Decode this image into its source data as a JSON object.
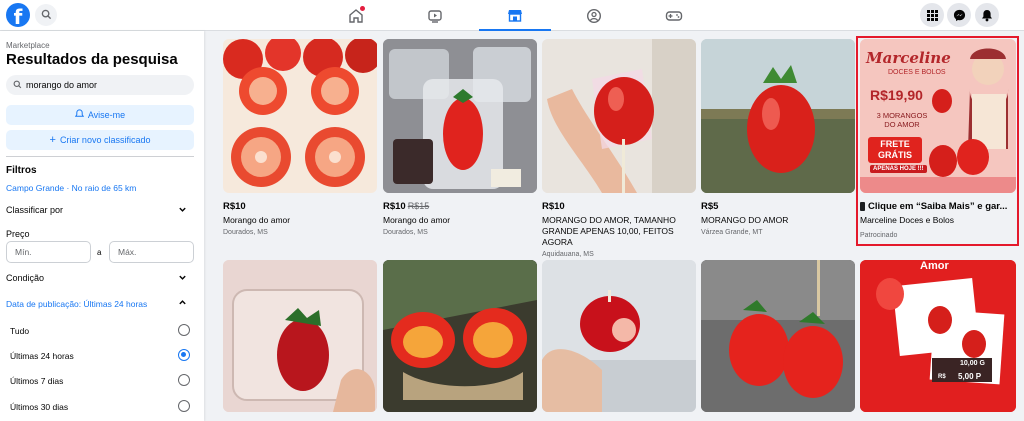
{
  "topbar": {
    "logo_letter": "f",
    "nav": [
      "home-icon",
      "video-icon",
      "marketplace-icon",
      "groups-icon",
      "gaming-icon"
    ],
    "active_nav": "marketplace-icon"
  },
  "sidebar": {
    "breadcrumb": "Marketplace",
    "title": "Resultados da pesquisa",
    "search_value": "morango do amor",
    "notify_label": "Avise-me",
    "create_label": "Criar novo classificado",
    "filters_title": "Filtros",
    "location_link": "Campo Grande · No raio de 65 km",
    "sort_label": "Classificar por",
    "price_label": "Preço",
    "price_min_placeholder": "Mín.",
    "price_sep": "a",
    "price_max_placeholder": "Máx.",
    "condition_label": "Condição",
    "date_label": "Data de publicação: Últimas 24 horas",
    "date_options": [
      {
        "label": "Tudo",
        "selected": false
      },
      {
        "label": "Últimas 24 horas",
        "selected": true
      },
      {
        "label": "Últimos 7 dias",
        "selected": false
      },
      {
        "label": "Últimos 30 dias",
        "selected": false
      }
    ]
  },
  "listings_row1": [
    {
      "price": "R$10",
      "old_price": "",
      "title": "Morango do amor",
      "location": "Dourados, MS"
    },
    {
      "price": "R$10",
      "old_price": "R$15",
      "title": "Morango do amor",
      "location": "Dourados, MS"
    },
    {
      "price": "R$10",
      "old_price": "",
      "title": "MORANGO DO AMOR, TAMANHO GRANDE APENAS 10,00, FEITOS AGORA",
      "location": "Aquidauana, MS"
    },
    {
      "price": "R$5",
      "old_price": "",
      "title": "MORANGO DO AMOR",
      "location": "Várzea Grande, MT"
    }
  ],
  "ad": {
    "brand": "Marceline",
    "brand_sub": "DOCES E BOLOS",
    "price_big": "R$19,90",
    "promo": "3 MORANGOS DO AMOR",
    "frete": "FRETE GRÁTIS",
    "today": "APENAS HOJE !!!",
    "headline": "Clique em “Saiba Mais” e gar...",
    "advertiser": "Marceline Doces e Bolos",
    "sponsored": "Patrocinado"
  },
  "ad2": {
    "word": "Amor",
    "price1": "10,00 G",
    "currency": "R$",
    "price2": "5,00 P"
  },
  "colors": {
    "accent": "#1877f2",
    "highlight": "#e4192b"
  }
}
